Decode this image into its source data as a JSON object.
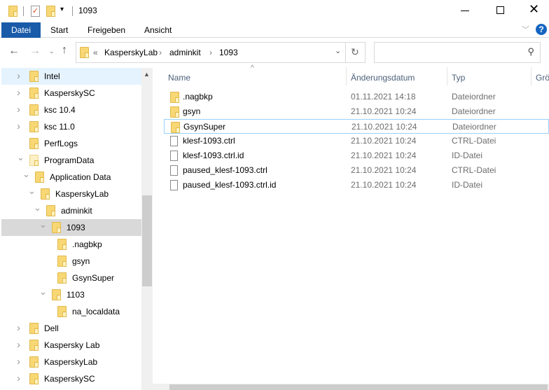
{
  "window": {
    "title": "1093",
    "minimize_icon": "minimize-icon",
    "maximize_icon": "maximize-icon",
    "close_icon": "close-icon"
  },
  "ribbon": {
    "tabs": [
      "Datei",
      "Start",
      "Freigeben",
      "Ansicht"
    ]
  },
  "address": {
    "overflow": "«",
    "crumbs": [
      "KasperskyLab",
      "adminkit",
      "1093"
    ]
  },
  "search": {
    "placeholder": ""
  },
  "tree": [
    {
      "label": "Intel",
      "level": 0,
      "chev": ">",
      "hover": true
    },
    {
      "label": "KasperskySC",
      "level": 0,
      "chev": ">"
    },
    {
      "label": "ksc 10.4",
      "level": 0,
      "chev": ">"
    },
    {
      "label": "ksc 11.0",
      "level": 0,
      "chev": ">"
    },
    {
      "label": "PerfLogs",
      "level": 0,
      "chev": ""
    },
    {
      "label": "ProgramData",
      "level": 0,
      "chev": "v",
      "pale": true
    },
    {
      "label": "Application Data",
      "level": 1,
      "chev": "v"
    },
    {
      "label": "KasperskyLab",
      "level": 2,
      "chev": "v"
    },
    {
      "label": "adminkit",
      "level": 3,
      "chev": "v"
    },
    {
      "label": "1093",
      "level": 4,
      "chev": "v",
      "selected": true
    },
    {
      "label": ".nagbkp",
      "level": 5,
      "chev": ""
    },
    {
      "label": "gsyn",
      "level": 5,
      "chev": ""
    },
    {
      "label": "GsynSuper",
      "level": 5,
      "chev": ""
    },
    {
      "label": "1103",
      "level": 4,
      "chev": "v"
    },
    {
      "label": "na_localdata",
      "level": 5,
      "chev": ""
    },
    {
      "label": "Dell",
      "level": 0,
      "chev": ">"
    },
    {
      "label": "Kaspersky Lab",
      "level": 0,
      "chev": ">"
    },
    {
      "label": "KasperskyLab",
      "level": 0,
      "chev": ">"
    },
    {
      "label": "KasperskySC",
      "level": 0,
      "chev": ">"
    }
  ],
  "columns": {
    "name": "Name",
    "date": "Änderungsdatum",
    "type": "Typ",
    "size": "Grö"
  },
  "files": [
    {
      "name": ".nagbkp",
      "date": "01.11.2021 14:18",
      "type": "Dateiordner",
      "kind": "folder"
    },
    {
      "name": "gsyn",
      "date": "21.10.2021 10:24",
      "type": "Dateiordner",
      "kind": "folder"
    },
    {
      "name": "GsynSuper",
      "date": "21.10.2021 10:24",
      "type": "Dateiordner",
      "kind": "folder",
      "focused": true
    },
    {
      "name": "klesf-1093.ctrl",
      "date": "21.10.2021 10:24",
      "type": "CTRL-Datei",
      "kind": "file"
    },
    {
      "name": "klesf-1093.ctrl.id",
      "date": "21.10.2021 10:24",
      "type": "ID-Datei",
      "kind": "file"
    },
    {
      "name": "paused_klesf-1093.ctrl",
      "date": "21.10.2021 10:24",
      "type": "CTRL-Datei",
      "kind": "file"
    },
    {
      "name": "paused_klesf-1093.ctrl.id",
      "date": "21.10.2021 10:24",
      "type": "ID-Datei",
      "kind": "file"
    }
  ],
  "colors": {
    "accent": "#195ba8",
    "selected": "#d9d9d9",
    "hover": "#e5f3ff",
    "focus": "#99d1ff"
  }
}
